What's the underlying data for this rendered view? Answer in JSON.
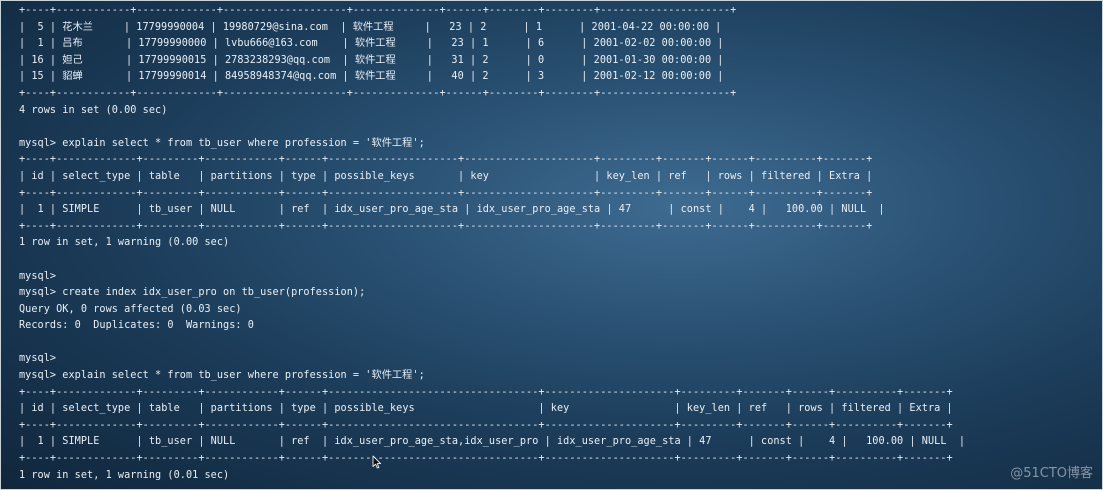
{
  "terminal": {
    "lines": [
      "+----+------------+-------------+--------------------+--------------+------+--------+--------+---------------------+",
      "|  5 | 花木兰     | 17799990004 | 19980729@sina.com  | 软件工程     |   23 | 2      | 1      | 2001-04-22 00:00:00 |",
      "|  1 | 吕布       | 17799990000 | lvbu666@163.com    | 软件工程     |   23 | 1      | 6      | 2001-02-02 00:00:00 |",
      "| 16 | 妲己       | 17799990015 | 2783238293@qq.com  | 软件工程     |   31 | 2      | 0      | 2001-01-30 00:00:00 |",
      "| 15 | 貂蝉       | 17799990014 | 84958948374@qq.com | 软件工程     |   40 | 2      | 3      | 2001-02-12 00:00:00 |",
      "+----+------------+-------------+--------------------+--------------+------+--------+--------+---------------------+",
      "4 rows in set (0.00 sec)",
      "",
      "mysql> explain select * from tb_user where profession = '软件工程';",
      "+----+-------------+---------+------------+------+---------------------+---------------------+---------+-------+------+----------+-------+",
      "| id | select_type | table   | partitions | type | possible_keys       | key                 | key_len | ref   | rows | filtered | Extra |",
      "+----+-------------+---------+------------+------+---------------------+---------------------+---------+-------+------+----------+-------+",
      "|  1 | SIMPLE      | tb_user | NULL       | ref  | idx_user_pro_age_sta | idx_user_pro_age_sta | 47      | const |    4 |   100.00 | NULL  |",
      "+----+-------------+---------+------------+------+---------------------+---------------------+---------+-------+------+----------+-------+",
      "1 row in set, 1 warning (0.00 sec)",
      "",
      "mysql>",
      "mysql> create index idx_user_pro on tb_user(profession);",
      "Query OK, 0 rows affected (0.03 sec)",
      "Records: 0  Duplicates: 0  Warnings: 0",
      "",
      "mysql>",
      "mysql> explain select * from tb_user where profession = '软件工程';",
      "+----+-------------+---------+------------+------+----------------------------------+---------------------+---------+-------+------+----------+-------+",
      "| id | select_type | table   | partitions | type | possible_keys                    | key                 | key_len | ref   | rows | filtered | Extra |",
      "+----+-------------+---------+------------+------+----------------------------------+---------------------+---------+-------+------+----------+-------+",
      "|  1 | SIMPLE      | tb_user | NULL       | ref  | idx_user_pro_age_sta,idx_user_pro | idx_user_pro_age_sta | 47      | const |    4 |   100.00 | NULL  |",
      "+----+-------------+---------+------------+------+----------------------------------+---------------------+---------+-------+------+----------+-------+",
      "1 row in set, 1 warning (0.01 sec)"
    ]
  },
  "watermark": "@51CTO博客",
  "cursor_icon": "mouse-pointer-icon"
}
